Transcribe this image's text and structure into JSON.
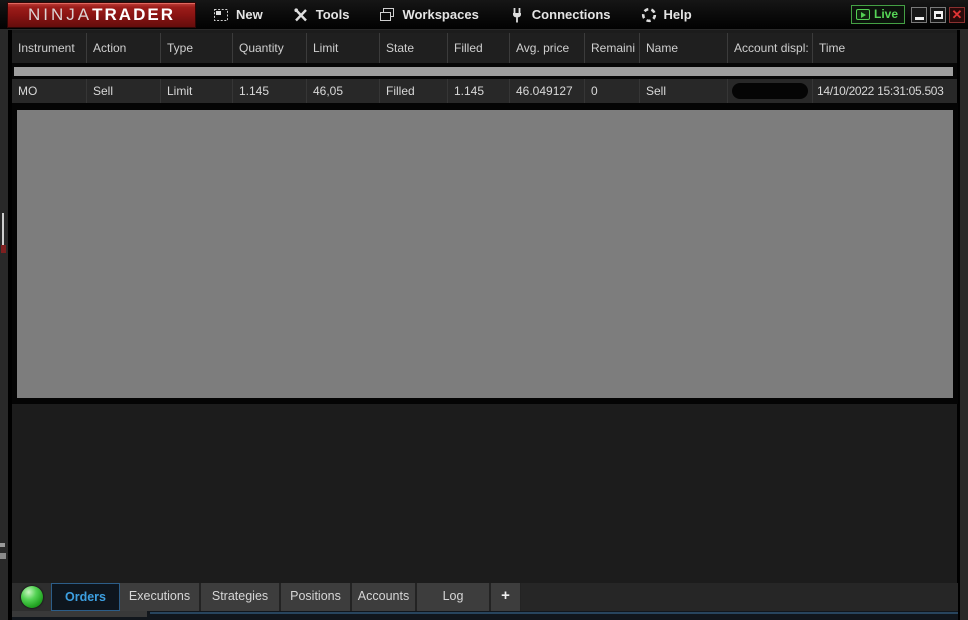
{
  "titlebar": {
    "logo": {
      "part1": "NINJA",
      "part2": "TRADER"
    },
    "menus": [
      "New",
      "Tools",
      "Workspaces",
      "Connections",
      "Help"
    ],
    "live_label": "Live",
    "close_glyph": "✕",
    "icons": {
      "new": "framed-window",
      "tools": "crossed-tools",
      "workspaces": "stacked-windows",
      "connections": "plug",
      "help": "segmented-circle",
      "live": "play-badge",
      "minimize": "bar",
      "maximize": "square-outline",
      "close": "x",
      "status": "green-orb",
      "add_tab": "plus"
    }
  },
  "orders_table": {
    "columns": [
      "Instrument",
      "Action",
      "Type",
      "Quantity",
      "Limit",
      "State",
      "Filled",
      "Avg. price",
      "Remaini",
      "Name",
      "Account displ:",
      "Time"
    ],
    "row": {
      "instrument": "MO",
      "action": "Sell",
      "type": "Limit",
      "quantity": "1.145",
      "limit": "46,05",
      "state": "Filled",
      "filled": "1.145",
      "avg_price": "46.049127",
      "remaining": "0",
      "name": "Sell",
      "account_redacted": true,
      "time": "14/10/2022 15:31:05.503"
    }
  },
  "tabs": {
    "items": [
      {
        "label": "Orders",
        "active": true
      },
      {
        "label": "Executions",
        "active": false
      },
      {
        "label": "Strategies",
        "active": false
      },
      {
        "label": "Positions",
        "active": false
      },
      {
        "label": "Accounts",
        "active": false
      },
      {
        "label": "Log",
        "active": false
      }
    ],
    "add_label": "+"
  },
  "colors": {
    "accent_blue": "#3d9fe0",
    "live_green": "#53cf53",
    "logo_red": "#8a1413",
    "redaction_gray": "#7d7d7d",
    "status_orb_green": "#55d355"
  }
}
